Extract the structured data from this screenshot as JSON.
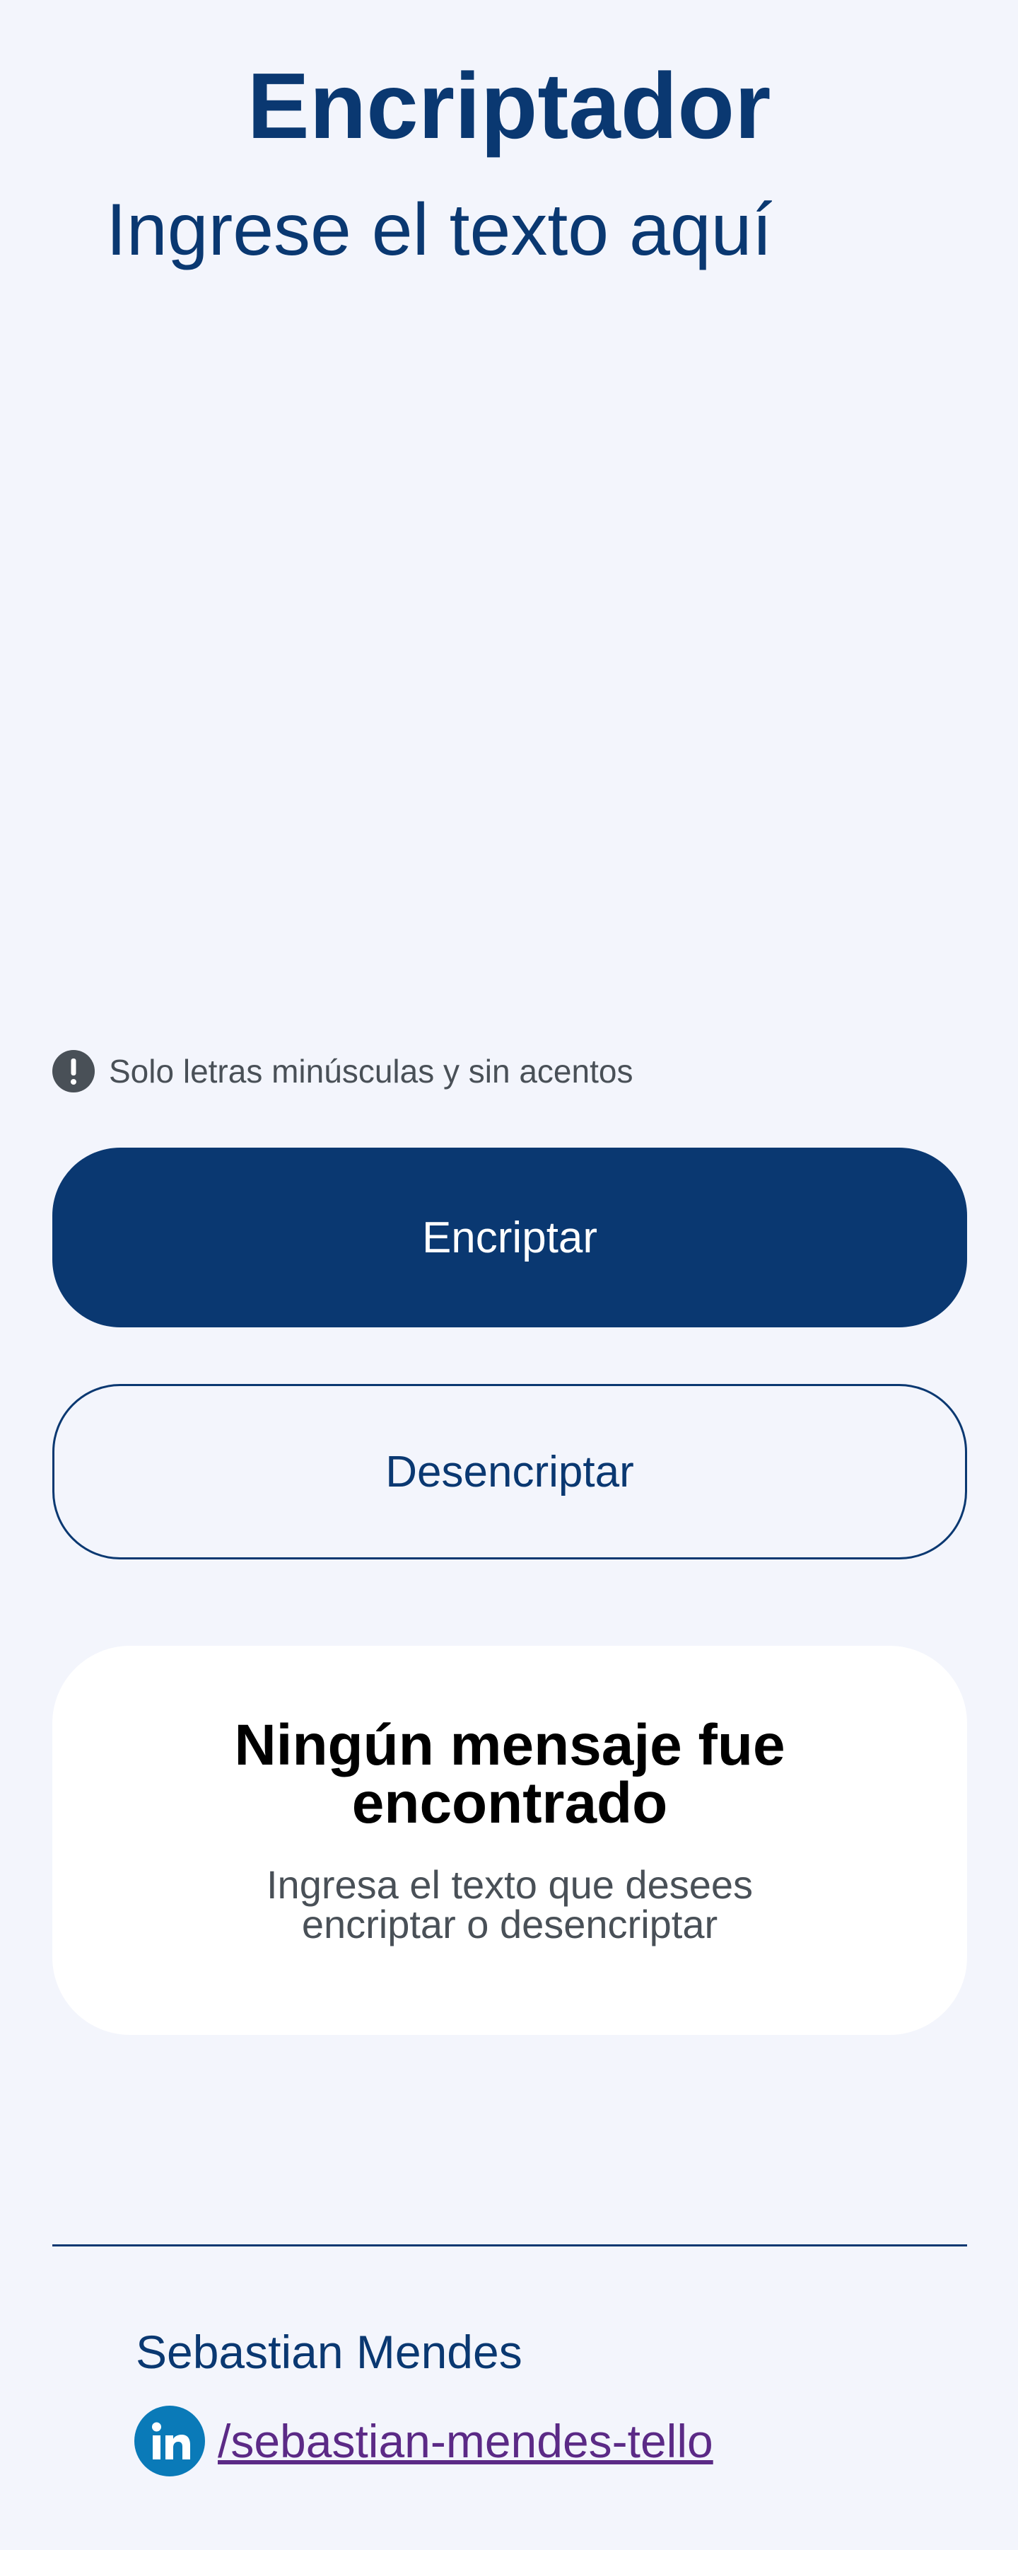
{
  "header": {
    "title": "Encriptador"
  },
  "input": {
    "placeholder": "Ingrese el texto aquí",
    "value": ""
  },
  "hint": {
    "icon": "exclamation-icon",
    "text": "Solo letras minúsculas y sin acentos"
  },
  "buttons": {
    "encrypt_label": "Encriptar",
    "decrypt_label": "Desencriptar"
  },
  "output": {
    "title": "Ningún mensaje fue encontrado",
    "subtitle": "Ingresa el texto que desees encriptar o desencriptar"
  },
  "footer": {
    "author": "Sebastian Mendes",
    "social_icon": "linkedin-icon",
    "social_link": "/sebastian-mendes-tello"
  },
  "colors": {
    "primary": "#0A3871",
    "background": "#F3F5FC",
    "card": "#FFFFFF",
    "muted": "#495057",
    "link": "#5B2A86",
    "linkedin": "#0A7AB8"
  }
}
